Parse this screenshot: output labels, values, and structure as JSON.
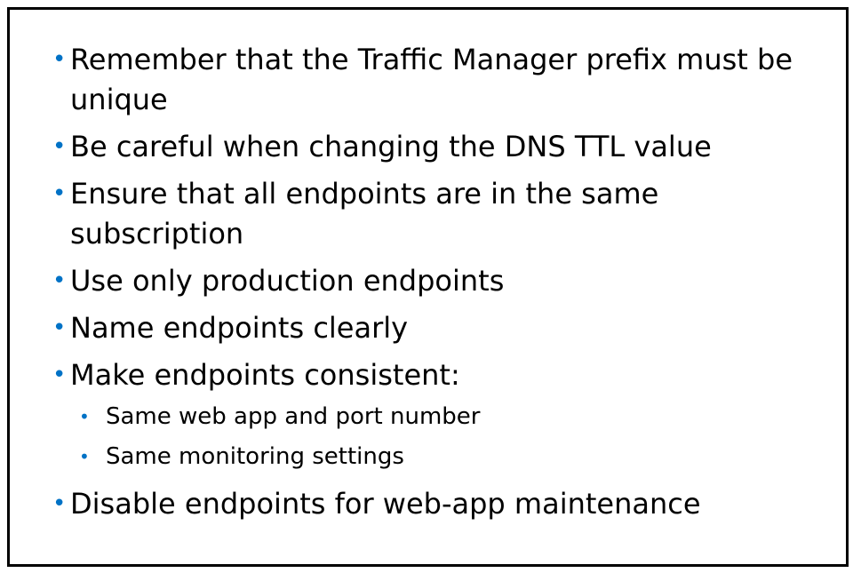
{
  "colors": {
    "bullet": "#0072C6",
    "text": "#000000",
    "border": "#000000"
  },
  "bullet_glyph": "•",
  "items": [
    {
      "text": "Remember that the Traffic Manager prefix must be unique"
    },
    {
      "text": "Be careful when changing the DNS TTL value"
    },
    {
      "text": "Ensure that all endpoints are in the same subscription"
    },
    {
      "text": "Use only production endpoints"
    },
    {
      "text": "Name endpoints clearly"
    },
    {
      "text": "Make endpoints consistent:",
      "sub_items": [
        {
          "text": "Same web app and port number"
        },
        {
          "text": "Same monitoring settings"
        }
      ]
    },
    {
      "text": "Disable endpoints for web-app maintenance"
    }
  ]
}
